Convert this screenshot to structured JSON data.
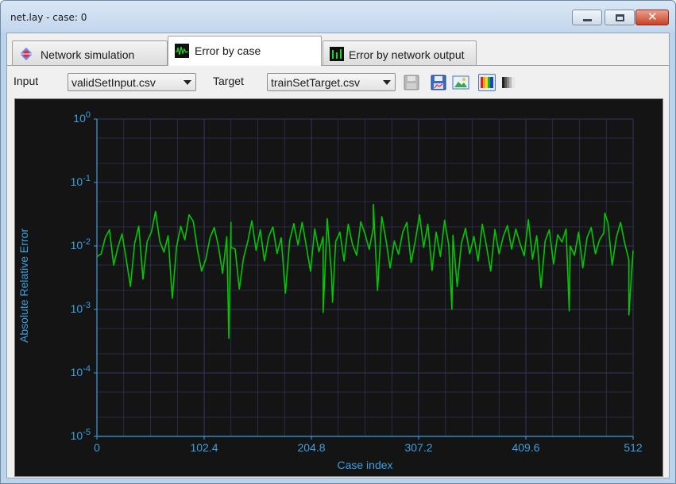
{
  "window": {
    "title": "net.lay - case: 0"
  },
  "tabs": [
    {
      "label": "Network simulation",
      "icon": "network-icon",
      "active": false
    },
    {
      "label": "Error by case",
      "icon": "waveform-icon",
      "active": true
    },
    {
      "label": "Error by network output",
      "icon": "bar-meter-icon",
      "active": false
    }
  ],
  "toolbar": {
    "input_label": "Input",
    "input_value": "validSetInput.csv",
    "target_label": "Target",
    "target_value": "trainSetTarget.csv",
    "tools": [
      "save-disk-icon",
      "save-image-icon",
      "export-picture-icon",
      "color-palette-icon",
      "grayscale-palette-icon"
    ]
  },
  "colors": {
    "plot_background": "#141414",
    "grid": "#34345c",
    "axis_text": "#3b9fe0",
    "series": "#00c800"
  },
  "chart_data": {
    "type": "line",
    "title": "",
    "xlabel": "Case index",
    "ylabel": "Absolute Relative Error",
    "xlim": [
      0,
      512
    ],
    "ylim": [
      1e-05,
      1
    ],
    "yscale": "log",
    "grid": true,
    "x_ticks": [
      "0",
      "102.4",
      "204.8",
      "307.2",
      "409.6",
      "512"
    ],
    "y_ticks": [
      {
        "base": "10",
        "exp": "0"
      },
      {
        "base": "10",
        "exp": "-1"
      },
      {
        "base": "10",
        "exp": "-2"
      },
      {
        "base": "10",
        "exp": "-3"
      },
      {
        "base": "10",
        "exp": "-4"
      },
      {
        "base": "10",
        "exp": "-5"
      }
    ],
    "series": [
      {
        "x_start": 0,
        "x_step": 4,
        "values": [
          0.0068,
          0.0075,
          0.0135,
          0.018,
          0.005,
          0.0095,
          0.0155,
          0.0062,
          0.0023,
          0.011,
          0.0205,
          0.003,
          0.0118,
          0.0165,
          0.035,
          0.012,
          0.008,
          0.0145,
          0.0015,
          0.0095,
          0.0205,
          0.0125,
          0.031,
          0.0245,
          0.0087,
          0.004,
          0.0062,
          0.0135,
          0.0195,
          0.01,
          0.0037,
          0.014,
          0.0235,
          0.009,
          0.0021,
          0.0065,
          0.0115,
          0.025,
          0.0085,
          0.018,
          0.0058,
          0.0139,
          0.02,
          0.0076,
          0.0135,
          0.0018,
          0.012,
          0.0225,
          0.0104,
          0.0235,
          0.0098,
          0.004,
          0.0185,
          0.0081,
          0.014,
          0.027,
          0.0036,
          0.0117,
          0.0165,
          0.0058,
          0.022,
          0.0106,
          0.0071,
          0.024,
          0.0155,
          0.0088,
          0.0195,
          0.002,
          0.029,
          0.0125,
          0.0045,
          0.012,
          0.0074,
          0.0165,
          0.0235,
          0.0055,
          0.012,
          0.031,
          0.0095,
          0.022,
          0.0041,
          0.0165,
          0.0068,
          0.0255,
          0.0102,
          0.0148,
          0.0023,
          0.0109,
          0.019,
          0.0075,
          0.0142,
          0.0058,
          0.022,
          0.01,
          0.004,
          0.0182,
          0.0075,
          0.014,
          0.021,
          0.0089,
          0.0185,
          0.011,
          0.007,
          0.026,
          0.0062,
          0.0145,
          0.0022,
          0.012,
          0.018,
          0.0052,
          0.015,
          0.0115,
          0.0185,
          0.01,
          0.0071,
          0.0165,
          0.0045,
          0.0135,
          0.0195,
          0.0075,
          0.0125,
          0.016,
          0.023,
          0.005,
          0.0135,
          0.0235,
          0.011,
          0.006,
          0.0085
        ]
      },
      {
        "points": [
          [
            126,
            0.00035
          ],
          [
            128,
            0.0095
          ],
          [
            216,
            0.0009
          ],
          [
            225,
            0.0013
          ],
          [
            264,
            0.045
          ],
          [
            339,
            0.001
          ],
          [
            451,
            0.00095
          ],
          [
            485,
            0.033
          ],
          [
            508,
            0.00082
          ]
        ]
      }
    ]
  }
}
